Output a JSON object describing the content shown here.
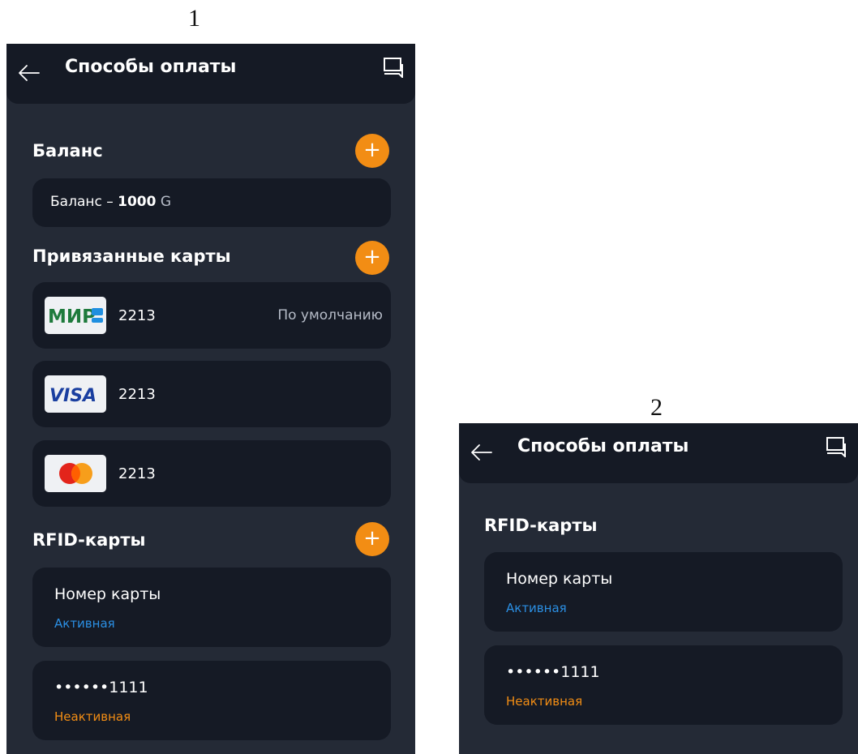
{
  "figures": [
    {
      "label": "1",
      "header": {
        "title": "Способы оплаты",
        "back_icon": "arrow-left-icon",
        "chat_icon": "chat-icon"
      },
      "balance": {
        "title": "Баланс",
        "text_prefix": "Баланс – ",
        "amount": "1000",
        "currency": "G"
      },
      "linked_cards": {
        "title": "Привязанные карты",
        "items": [
          {
            "brand": "МИР",
            "number": "2213",
            "note": "По умолчанию"
          },
          {
            "brand": "VISA",
            "number": "2213",
            "note": ""
          },
          {
            "brand": "mastercard",
            "number": "2213",
            "note": ""
          }
        ]
      },
      "rfid": {
        "title": "RFID-карты",
        "items": [
          {
            "name": "Номер карты",
            "status": "Активная",
            "status_color": "#2b8fe3"
          },
          {
            "name": "••••••1111",
            "status": "Неактивная",
            "status_color": "#f28d14"
          }
        ]
      },
      "add_label": "+"
    },
    {
      "label": "2",
      "header": {
        "title": "Способы оплаты",
        "back_icon": "arrow-left-icon",
        "chat_icon": "chat-icon"
      },
      "rfid": {
        "title": "RFID-карты",
        "items": [
          {
            "name": "Номер карты",
            "status": "Активная",
            "status_color": "#2b8fe3"
          },
          {
            "name": "••••••1111",
            "status": "Неактивная",
            "status_color": "#f28d14"
          }
        ]
      }
    }
  ],
  "colors": {
    "background": "#242a36",
    "surface": "#151a25",
    "accent": "#f28d14",
    "active": "#2b8fe3"
  }
}
